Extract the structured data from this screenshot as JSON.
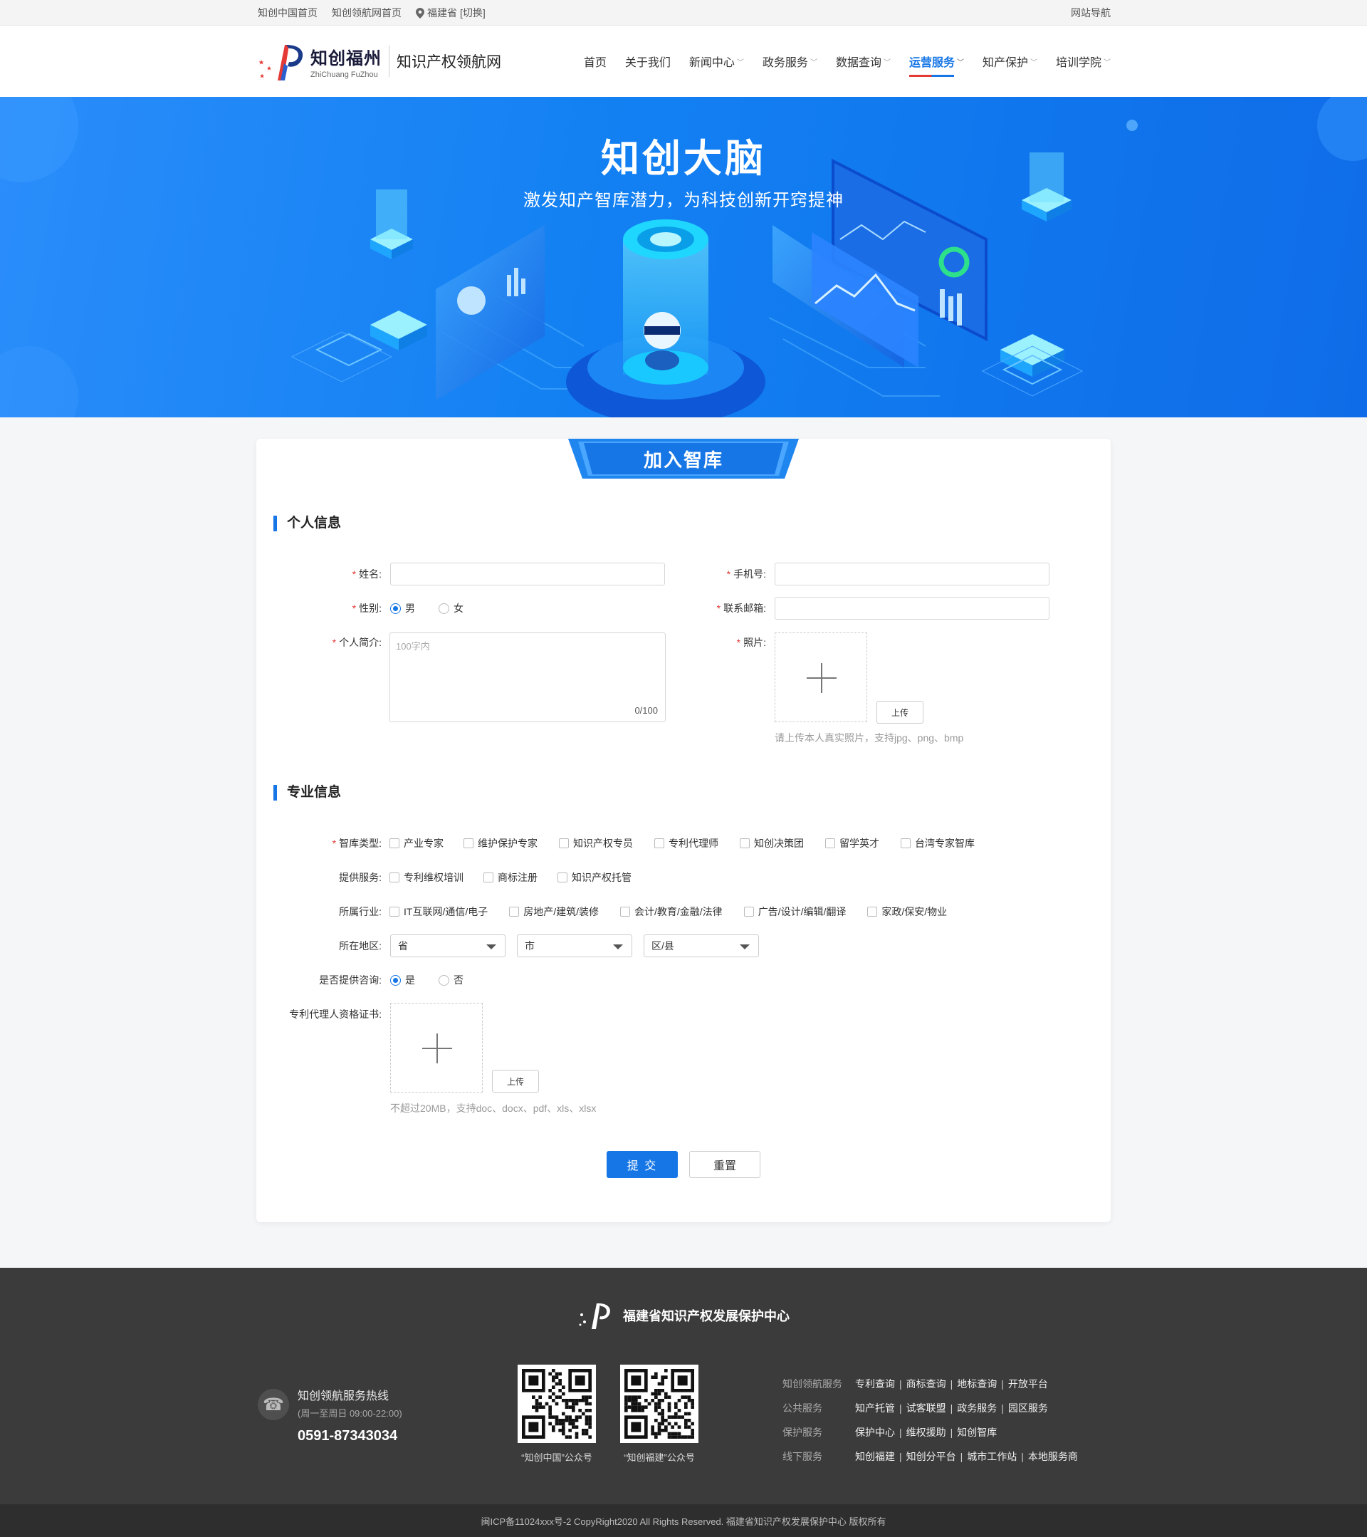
{
  "topbar": {
    "links": [
      "知创中国首页",
      "知创领航网首页"
    ],
    "location": "福建省",
    "switch": "[切换]",
    "site_nav": "网站导航"
  },
  "header": {
    "logo_cn": "知创福州",
    "logo_en": "ZhiChuang FuZhou",
    "site_name": "知识产权领航网",
    "nav": [
      {
        "label": "首页"
      },
      {
        "label": "关于我们"
      },
      {
        "label": "新闻中心"
      },
      {
        "label": "政务服务"
      },
      {
        "label": "数据查询"
      },
      {
        "label": "运营服务"
      },
      {
        "label": "知产保护"
      },
      {
        "label": "培训学院"
      }
    ]
  },
  "banner": {
    "title": "知创大脑",
    "subtitle": "激发知产智库潜力，为科技创新开窍提神"
  },
  "form": {
    "tab_label": "加入智库",
    "personal_title": "个人信息",
    "name_label": "姓名:",
    "phone_label": "手机号:",
    "gender_label": "性别:",
    "gender_male": "男",
    "gender_female": "女",
    "email_label": "联系邮箱:",
    "intro_label": "个人简介:",
    "intro_placeholder": "100字内",
    "intro_count": "0/100",
    "photo_label": "照片:",
    "upload_label": "上传",
    "photo_hint": "请上传本人真实照片，支持jpg、png、bmp",
    "professional_title": "专业信息",
    "think_tank_label": "智库类型:",
    "think_tank_options": [
      "产业专家",
      "维护保护专家",
      "知识产权专员",
      "专利代理师",
      "知创决策团",
      "留学英才",
      "台湾专家智库"
    ],
    "services_label": "提供服务:",
    "services_options": [
      "专利维权培训",
      "商标注册",
      "知识产权托管"
    ],
    "industry_label": "所属行业:",
    "industry_options": [
      "IT互联网/通信/电子",
      "房地产/建筑/装修",
      "会计/教育/金融/法律",
      "广告/设计/编辑/翻译",
      "家政/保安/物业"
    ],
    "region_label": "所在地区:",
    "region_province": "省",
    "region_city": "市",
    "region_county": "区/县",
    "consult_label": "是否提供咨询:",
    "consult_yes": "是",
    "consult_no": "否",
    "cert_label": "专利代理人资格证书:",
    "cert_upload_label": "上传",
    "cert_hint": "不超过20MB，支持doc、docx、pdf、xls、xlsx",
    "submit_label": "提 交",
    "reset_label": "重置"
  },
  "footer": {
    "brand": "福建省知识产权发展保护中心",
    "hotline_title": "知创领航服务热线",
    "hotline_hours": "(周一至周日 09:00-22:00)",
    "hotline_number": "0591-87343034",
    "qr1_caption": "“知创中国”公众号",
    "qr2_caption": "“知创福建”公众号",
    "link_groups": [
      {
        "category": "知创领航服务",
        "links": [
          "专利查询",
          "商标查询",
          "地标查询",
          "开放平台"
        ]
      },
      {
        "category": "公共服务",
        "links": [
          "知产托管",
          "试客联盟",
          "政务服务",
          "园区服务"
        ]
      },
      {
        "category": "保护服务",
        "links": [
          "保护中心",
          "维权援助",
          "知创智库"
        ]
      },
      {
        "category": "线下服务",
        "links": [
          "知创福建",
          "知创分平台",
          "城市工作站",
          "本地服务商"
        ]
      }
    ],
    "copyright": "闽ICP备11024xxx号-2  CopyRight2020  All Rights Reserved.  福建省知识产权发展保护中心  版权所有"
  },
  "colors": {
    "accent": "#1676e6",
    "required": "#e53935",
    "footer_bg": "#3b3b3b"
  }
}
